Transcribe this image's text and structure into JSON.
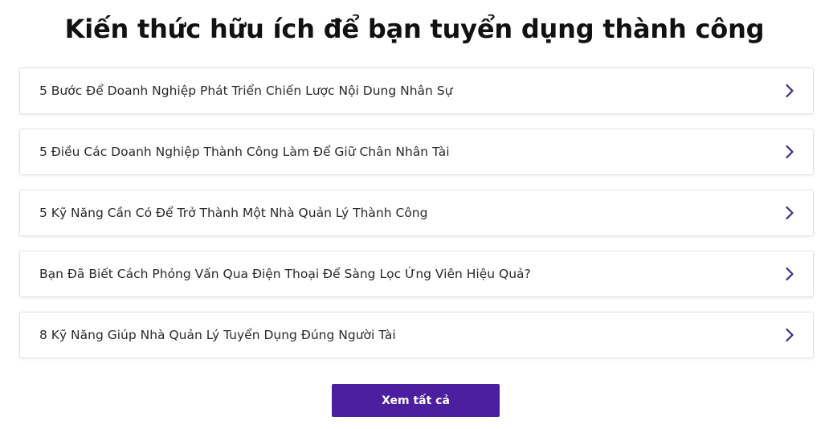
{
  "section": {
    "title": "Kiến thức hữu ích để bạn tuyển dụng thành công"
  },
  "articles": [
    {
      "label": "5 Bước Để Doanh Nghiệp Phát Triển Chiến Lược Nội Dung Nhân Sự",
      "icon": "chevron-right-icon"
    },
    {
      "label": "5 Điều Các Doanh Nghiệp Thành Công Làm Để Giữ Chân Nhân Tài",
      "icon": "chevron-right-icon"
    },
    {
      "label": "5 Kỹ Năng Cần Có Để Trở Thành Một Nhà Quản Lý Thành Công",
      "icon": "chevron-right-icon"
    },
    {
      "label": "Bạn Đã Biết Cách Phỏng Vấn Qua Điện Thoại Để Sàng Lọc Ứng Viên Hiệu Quả?",
      "icon": "chevron-right-icon"
    },
    {
      "label": "8 Kỹ Năng Giúp Nhà Quản Lý Tuyển Dụng Đúng Người Tài",
      "icon": "chevron-right-icon"
    }
  ],
  "view_all": {
    "label": "Xem tất cả"
  },
  "colors": {
    "accent": "#4b1fa0",
    "chevron": "#3d2a8c",
    "border": "#e4e4e4"
  }
}
